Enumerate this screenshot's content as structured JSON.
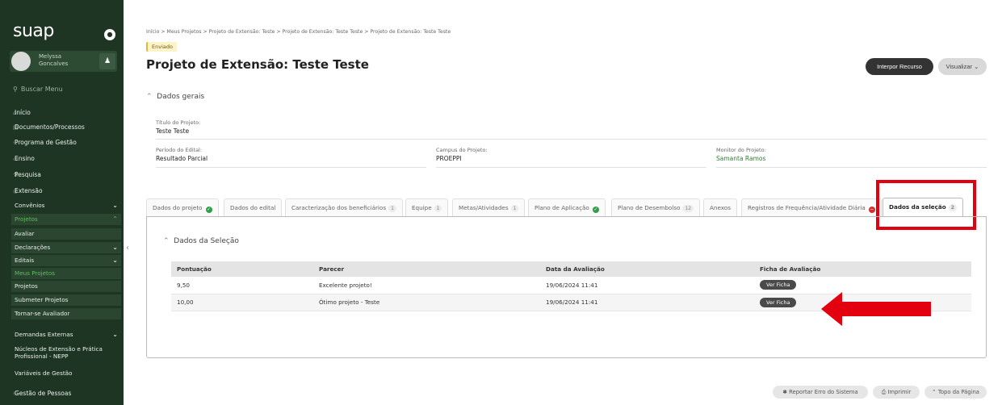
{
  "sidebar": {
    "logo": "suap",
    "user_name": "Melyssa Goncalves",
    "search_placeholder": "Buscar Menu",
    "items": [
      {
        "label": "Início"
      },
      {
        "label": "Documentos/Processos"
      },
      {
        "label": "Programa de Gestão"
      },
      {
        "label": "Ensino"
      },
      {
        "label": "Pesquisa"
      },
      {
        "label": "Extensão"
      }
    ],
    "sub_items": [
      {
        "label": "Convênios"
      },
      {
        "label": "Projetos"
      },
      {
        "label": "Avaliar"
      },
      {
        "label": "Declarações"
      },
      {
        "label": "Editais"
      },
      {
        "label": "Meus Projetos"
      },
      {
        "label": "Projetos"
      },
      {
        "label": "Submeter Projetos"
      },
      {
        "label": "Tornar-se Avaliador"
      },
      {
        "label": "Demandas Externas"
      },
      {
        "label": "Núcleos de Extensão e Prática Profissional - NEPP"
      },
      {
        "label": "Variáveis de Gestão"
      }
    ],
    "bottom_item": "Gestão de Pessoas"
  },
  "breadcrumb": "Início > Meus Projetos > Projeto de Extensão: Teste > Projeto de Extensão: Teste Teste > Projeto de Extensão: Teste Teste",
  "status_badge": "Enviado",
  "page_title": "Projeto de Extensão: Teste Teste",
  "actions": {
    "interpor_recurso": "Interpor Recurso",
    "visualizar": "Visualizar ⌄"
  },
  "dados_gerais": {
    "heading": "Dados gerais",
    "titulo_label": "Título do Projeto:",
    "titulo_value": "Teste Teste",
    "periodo_label": "Período do Edital:",
    "periodo_value": "Resultado Parcial",
    "campus_label": "Campus do Projeto:",
    "campus_value": "PROEPPI",
    "monitor_label": "Monitor do Projeto:",
    "monitor_value": "Samanta Ramos"
  },
  "tabs": [
    {
      "label": "Dados do projeto"
    },
    {
      "label": "Dados do edital"
    },
    {
      "label": "Caracterização dos beneficiários",
      "count": "1"
    },
    {
      "label": "Equipe",
      "count": "1"
    },
    {
      "label": "Metas/Atividades",
      "count": "1"
    },
    {
      "label": "Plano de Aplicação"
    },
    {
      "label": "Plano de Desembolso",
      "count": "12"
    },
    {
      "label": "Anexos"
    },
    {
      "label": "Registros de Frequência/Atividade Diária"
    },
    {
      "label": "Dados da seleção",
      "count": "2"
    }
  ],
  "selecao": {
    "heading": "Dados da Seleção",
    "columns": [
      "Pontuação",
      "Parecer",
      "Data da Avaliação",
      "Ficha de Avaliação"
    ],
    "rows": [
      {
        "pontuacao": "9,50",
        "parecer": "Excelente projeto!",
        "data": "19/06/2024 11:41",
        "ficha": "Ver Ficha"
      },
      {
        "pontuacao": "10,00",
        "parecer": "Ótimo projeto - Teste",
        "data": "19/06/2024 11:41",
        "ficha": "Ver Ficha"
      }
    ]
  },
  "footer": {
    "reportar": "Reportar Erro do Sistema",
    "imprimir": "Imprimir",
    "topo": "Topo da Página"
  },
  "colors": {
    "sidebar_bg": "#1f3524",
    "accent_green": "#2e7d32",
    "highlight_red": "#e3000f"
  }
}
